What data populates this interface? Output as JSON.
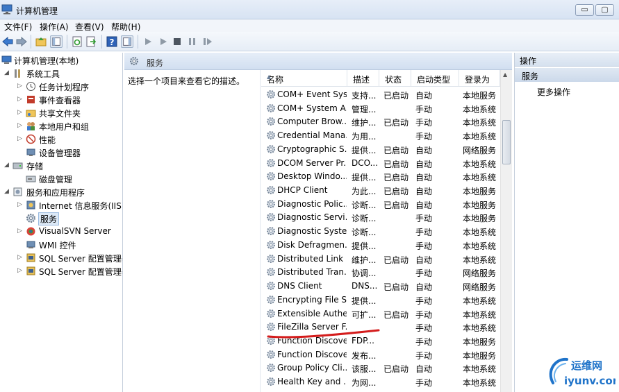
{
  "window": {
    "title": "计算机管理",
    "controls": {
      "minimize": "▭",
      "maximize": "▢"
    }
  },
  "menu": {
    "items": [
      "文件(F)",
      "操作(A)",
      "查看(V)",
      "帮助(H)"
    ]
  },
  "tree": {
    "root": "计算机管理(本地)",
    "items": [
      {
        "label": "系统工具",
        "icon": "tools-icon"
      },
      {
        "label": "任务计划程序",
        "icon": "clock-icon"
      },
      {
        "label": "事件查看器",
        "icon": "event-viewer-icon"
      },
      {
        "label": "共享文件夹",
        "icon": "shared-folder-icon"
      },
      {
        "label": "本地用户和组",
        "icon": "users-icon"
      },
      {
        "label": "性能",
        "icon": "performance-icon"
      },
      {
        "label": "设备管理器",
        "icon": "device-manager-icon"
      },
      {
        "label": "存储",
        "icon": "storage-icon"
      },
      {
        "label": "磁盘管理",
        "icon": "disk-icon"
      },
      {
        "label": "服务和应用程序",
        "icon": "services-apps-icon"
      },
      {
        "label": "Internet 信息服务(IIS)管",
        "icon": "iis-icon"
      },
      {
        "label": "服务",
        "icon": "gear-icon"
      },
      {
        "label": "VisualSVN Server",
        "icon": "svn-icon"
      },
      {
        "label": "WMI 控件",
        "icon": "wmi-icon"
      },
      {
        "label": "SQL Server 配置管理器",
        "icon": "sql-icon"
      },
      {
        "label": "SQL Server 配置管理器",
        "icon": "sql-icon"
      }
    ]
  },
  "center": {
    "title": "服务",
    "description_hint": "选择一个项目来查看它的描述。",
    "columns": [
      "名称",
      "描述",
      "状态",
      "启动类型",
      "登录为"
    ],
    "rows": [
      {
        "name": "COM+ Event Sys...",
        "desc": "支持...",
        "status": "已启动",
        "startup": "自动",
        "logon": "本地服务"
      },
      {
        "name": "COM+ System A...",
        "desc": "管理...",
        "status": "",
        "startup": "手动",
        "logon": "本地系统"
      },
      {
        "name": "Computer Brow...",
        "desc": "维护...",
        "status": "已启动",
        "startup": "手动",
        "logon": "本地系统"
      },
      {
        "name": "Credential Mana...",
        "desc": "为用...",
        "status": "",
        "startup": "手动",
        "logon": "本地系统"
      },
      {
        "name": "Cryptographic S...",
        "desc": "提供...",
        "status": "已启动",
        "startup": "自动",
        "logon": "网络服务"
      },
      {
        "name": "DCOM Server Pr...",
        "desc": "DCO...",
        "status": "已启动",
        "startup": "自动",
        "logon": "本地系统"
      },
      {
        "name": "Desktop Windo...",
        "desc": "提供...",
        "status": "已启动",
        "startup": "自动",
        "logon": "本地系统"
      },
      {
        "name": "DHCP Client",
        "desc": "为此...",
        "status": "已启动",
        "startup": "自动",
        "logon": "本地服务"
      },
      {
        "name": "Diagnostic Polic...",
        "desc": "诊断...",
        "status": "已启动",
        "startup": "自动",
        "logon": "本地服务"
      },
      {
        "name": "Diagnostic Servi...",
        "desc": "诊断...",
        "status": "",
        "startup": "手动",
        "logon": "本地服务"
      },
      {
        "name": "Diagnostic Syste...",
        "desc": "诊断...",
        "status": "",
        "startup": "手动",
        "logon": "本地系统"
      },
      {
        "name": "Disk Defragmen...",
        "desc": "提供...",
        "status": "",
        "startup": "手动",
        "logon": "本地系统"
      },
      {
        "name": "Distributed Link ...",
        "desc": "维护...",
        "status": "已启动",
        "startup": "自动",
        "logon": "本地系统"
      },
      {
        "name": "Distributed Tran...",
        "desc": "协调...",
        "status": "",
        "startup": "手动",
        "logon": "网络服务"
      },
      {
        "name": "DNS Client",
        "desc": "DNS...",
        "status": "已启动",
        "startup": "自动",
        "logon": "网络服务"
      },
      {
        "name": "Encrypting File S...",
        "desc": "提供...",
        "status": "",
        "startup": "手动",
        "logon": "本地系统"
      },
      {
        "name": "Extensible Authe...",
        "desc": "可扩...",
        "status": "已启动",
        "startup": "手动",
        "logon": "本地系统"
      },
      {
        "name": "FileZilla Server F...",
        "desc": "",
        "status": "",
        "startup": "手动",
        "logon": "本地系统"
      },
      {
        "name": "Function Discove...",
        "desc": "FDP...",
        "status": "",
        "startup": "手动",
        "logon": "本地服务"
      },
      {
        "name": "Function Discove...",
        "desc": "发布...",
        "status": "",
        "startup": "手动",
        "logon": "本地服务"
      },
      {
        "name": "Group Policy Cli...",
        "desc": "该服...",
        "status": "已启动",
        "startup": "自动",
        "logon": "本地系统"
      },
      {
        "name": "Health Key and ...",
        "desc": "为网...",
        "status": "",
        "startup": "手动",
        "logon": "本地系统"
      }
    ]
  },
  "actions": {
    "title": "操作",
    "section": "服务",
    "more": "更多操作"
  },
  "watermark": {
    "text1": "运维网",
    "text2": "iyunv.com"
  },
  "colors": {
    "accent": "#1f73c9",
    "highlight_line": "#d41c1c",
    "header_gradient": "#d1def0"
  }
}
